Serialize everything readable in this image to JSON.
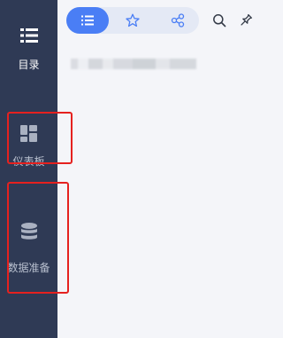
{
  "sidebar": {
    "items": [
      {
        "label": "目录",
        "icon": "list-icon",
        "active": true
      },
      {
        "label": "仪表板",
        "icon": "dashboard-icon",
        "active": false
      },
      {
        "label": "数据准备",
        "icon": "database-icon",
        "active": false
      }
    ]
  },
  "header": {
    "tabs": [
      {
        "icon": "list-icon",
        "active": true
      },
      {
        "icon": "star-icon",
        "active": false
      },
      {
        "icon": "share-icon",
        "active": false
      }
    ],
    "tools": [
      "search-icon",
      "pin-icon"
    ]
  },
  "colors": {
    "sidebar_bg": "#2f3a55",
    "accent": "#4a7ef5",
    "highlight": "#e5211f",
    "main_bg": "#f4f5f9"
  }
}
